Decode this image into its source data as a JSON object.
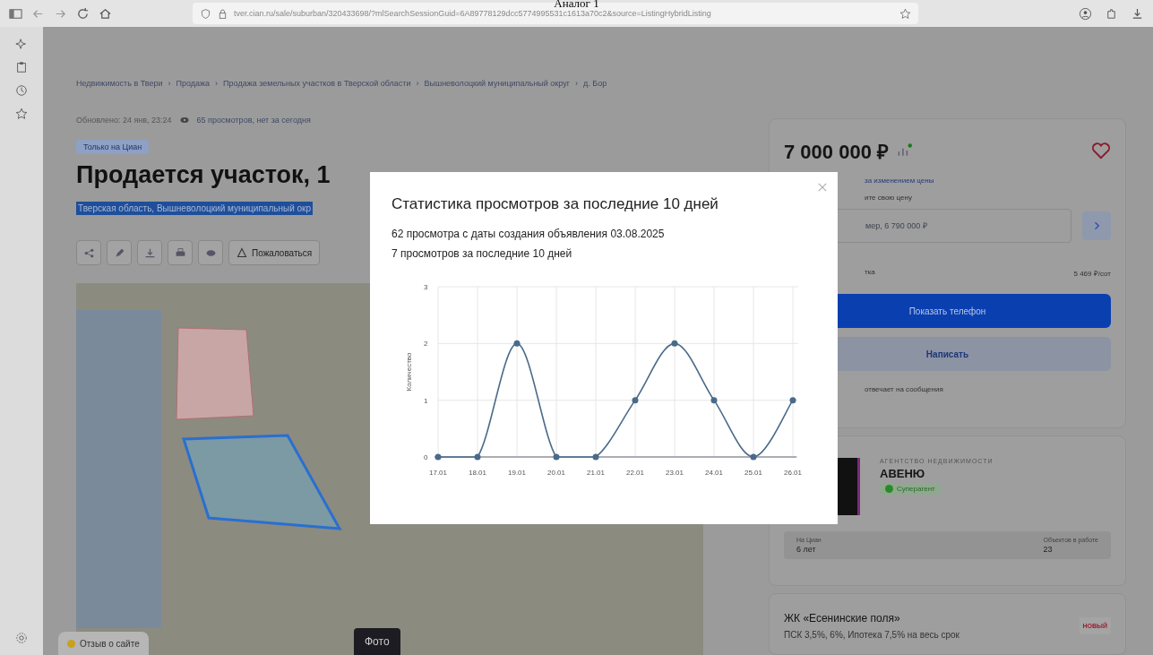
{
  "caption": "Аналог 1",
  "browser": {
    "url": "tver.cian.ru/sale/suburban/320433698/?mlSearchSessionGuid=6A89778129dcc5774995531c1613a70c2&source=ListingHybridListing"
  },
  "page": {
    "breadcrumbs": [
      "Недвижимость в Твери",
      "Продажа",
      "Продажа земельных участков в Тверской области",
      "Вышневолоцкий муниципальный округ",
      "д. Бор"
    ],
    "separator": "›",
    "updated": "Обновлено: 24 янв, 23:24",
    "views": "65 просмотров, нет за сегодня",
    "badge": "Только на Циан",
    "title": "Продается участок, 1",
    "address": "Тверская область, Вышневолоцкий муниципальный окр",
    "complain": "Пожаловаться",
    "feedback": "Отзыв о сайте",
    "photo_button": "Фото"
  },
  "offer": {
    "price": "7 000 000 ₽",
    "favorite": false,
    "price_watch": "за изменением цены",
    "offer_label": "ите свою цену",
    "offer_placeholder": "мер, 6 790 000 ₽",
    "per_unit_label": "тка",
    "per_unit": "5 469 ₽/сот",
    "show_phone": "Показать телефон",
    "write": "Написать",
    "reply_note": "отвечает на сообщения"
  },
  "agent": {
    "type": "АГЕНТСТВО НЕДВИЖИМОСТИ",
    "name": "АВЕНЮ",
    "badge": "Суперагент",
    "stats": [
      {
        "label": "На Циан",
        "value": "6 лет"
      },
      {
        "label": "Объектов в работе",
        "value": "23"
      }
    ]
  },
  "promo": {
    "title": "ЖК «Есенинские поля»",
    "text": "ПСК 3,5%, 6%, Ипотека 7,5% на весь срок",
    "logo": "НОВЫЙ"
  },
  "modal": {
    "title": "Статистика просмотров за последние 10 дней",
    "lines": [
      "62 просмотра с даты создания объявления 03.08.2025",
      "7 просмотров за последние 10 дней"
    ],
    "chart_data": {
      "type": "line",
      "ylabel": "Количество",
      "grid": true,
      "categories": [
        "17.01",
        "18.01",
        "19.01",
        "20.01",
        "21.01",
        "22.01",
        "23.01",
        "24.01",
        "25.01",
        "26.01"
      ],
      "series": [
        {
          "color": "#4a6a8a",
          "marker": true,
          "values": [
            0,
            0,
            2,
            0,
            0,
            1,
            2,
            1,
            0,
            1
          ]
        }
      ],
      "ylim": [
        0,
        3
      ],
      "yticks": [
        0,
        1,
        2,
        3
      ]
    }
  }
}
